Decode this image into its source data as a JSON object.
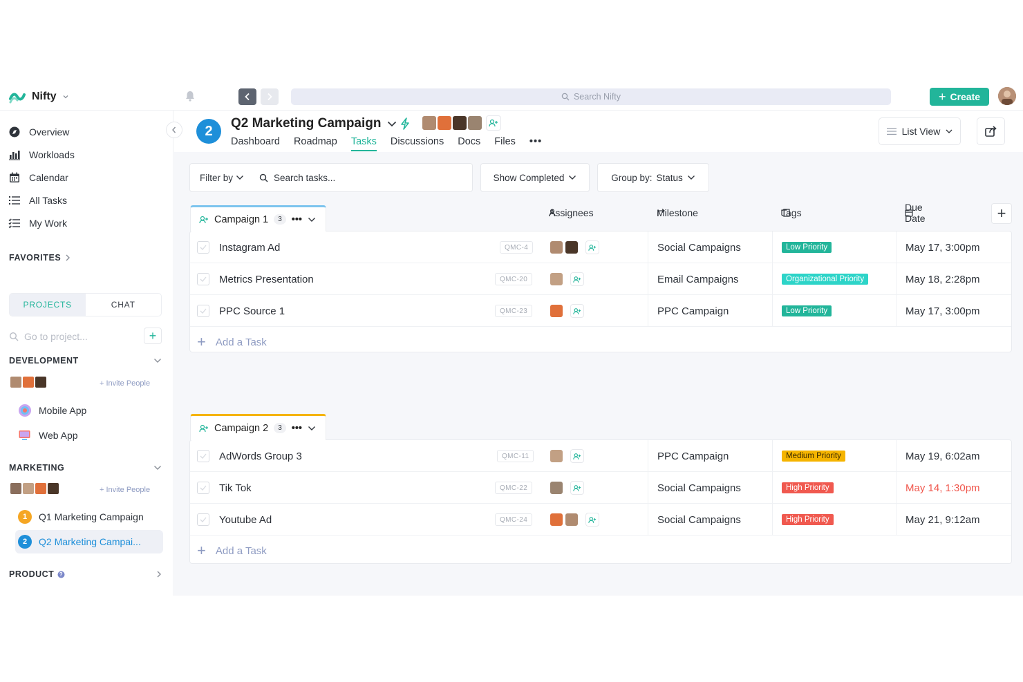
{
  "brand": {
    "name": "Nifty"
  },
  "search": {
    "placeholder": "Search Nifty"
  },
  "create_label": "Create",
  "colors": {
    "accent": "#22b59a",
    "blue": "#1e8fd9",
    "overdue": "#f0594f"
  },
  "sidebar": {
    "nav": [
      {
        "label": "Overview",
        "icon": "overview-icon"
      },
      {
        "label": "Workloads",
        "icon": "workloads-icon"
      },
      {
        "label": "Calendar",
        "icon": "calendar-icon"
      },
      {
        "label": "All Tasks",
        "icon": "list-icon"
      },
      {
        "label": "My Work",
        "icon": "checklist-icon"
      }
    ],
    "favorites": "FAVORITES",
    "tabs": {
      "projects": "PROJECTS",
      "chat": "CHAT"
    },
    "project_search_placeholder": "Go to project...",
    "sections": {
      "development": {
        "title": "DEVELOPMENT",
        "invite": "+ Invite People",
        "projects": [
          "Mobile App",
          "Web App"
        ]
      },
      "marketing": {
        "title": "MARKETING",
        "invite": "+ Invite People",
        "projects": [
          "Q1 Marketing Campaign",
          "Q2 Marketing Campai..."
        ]
      },
      "product": {
        "title": "PRODUCT"
      }
    },
    "marketing_nums": [
      "1",
      "2"
    ]
  },
  "project": {
    "badge": "2",
    "title": "Q2 Marketing Campaign",
    "tabs": [
      "Dashboard",
      "Roadmap",
      "Tasks",
      "Discussions",
      "Docs",
      "Files",
      "•••"
    ],
    "view": "List View"
  },
  "toolbar": {
    "filter_by": "Filter by",
    "search_tasks_placeholder": "Search tasks...",
    "show_completed": "Show Completed",
    "group_by_label": "Group by:",
    "group_by_value": "Status"
  },
  "columns": {
    "assignees": "Assignees",
    "milestone": "Milestone",
    "tags": "Tags",
    "due": "Due Date"
  },
  "groups": [
    {
      "name": "Campaign 1",
      "count": "3",
      "more": "•••",
      "tasks": [
        {
          "name": "Instagram Ad",
          "code": "QMC-4",
          "milestone": "Social Campaigns",
          "tag": "Low Priority",
          "tag_color": "#22b59a",
          "due": "May 17, 3:00pm",
          "overdue": false
        },
        {
          "name": "Metrics Presentation",
          "code": "QMC-20",
          "milestone": "Email Campaigns",
          "tag": "Organizational Priority",
          "tag_color": "#2dd4c8",
          "due": "May 18, 2:28pm",
          "overdue": false
        },
        {
          "name": "PPC Source 1",
          "code": "QMC-23",
          "milestone": "PPC Campaign",
          "tag": "Low Priority",
          "tag_color": "#22b59a",
          "due": "May 17, 3:00pm",
          "overdue": false
        }
      ],
      "add_task": "Add a Task"
    },
    {
      "name": "Campaign 2",
      "count": "3",
      "more": "•••",
      "tasks": [
        {
          "name": "AdWords Group 3",
          "code": "QMC-11",
          "milestone": "PPC Campaign",
          "tag": "Medium Priority",
          "tag_color": "#f5b400",
          "due": "May 19, 6:02am",
          "overdue": false
        },
        {
          "name": "Tik Tok",
          "code": "QMC-22",
          "milestone": "Social Campaigns",
          "tag": "High Priority",
          "tag_color": "#f0594f",
          "due": "May 14, 1:30pm",
          "overdue": true
        },
        {
          "name": "Youtube Ad",
          "code": "QMC-24",
          "milestone": "Social Campaigns",
          "tag": "High Priority",
          "tag_color": "#f0594f",
          "due": "May 21, 9:12am",
          "overdue": false
        }
      ],
      "add_task": "Add a Task"
    }
  ]
}
